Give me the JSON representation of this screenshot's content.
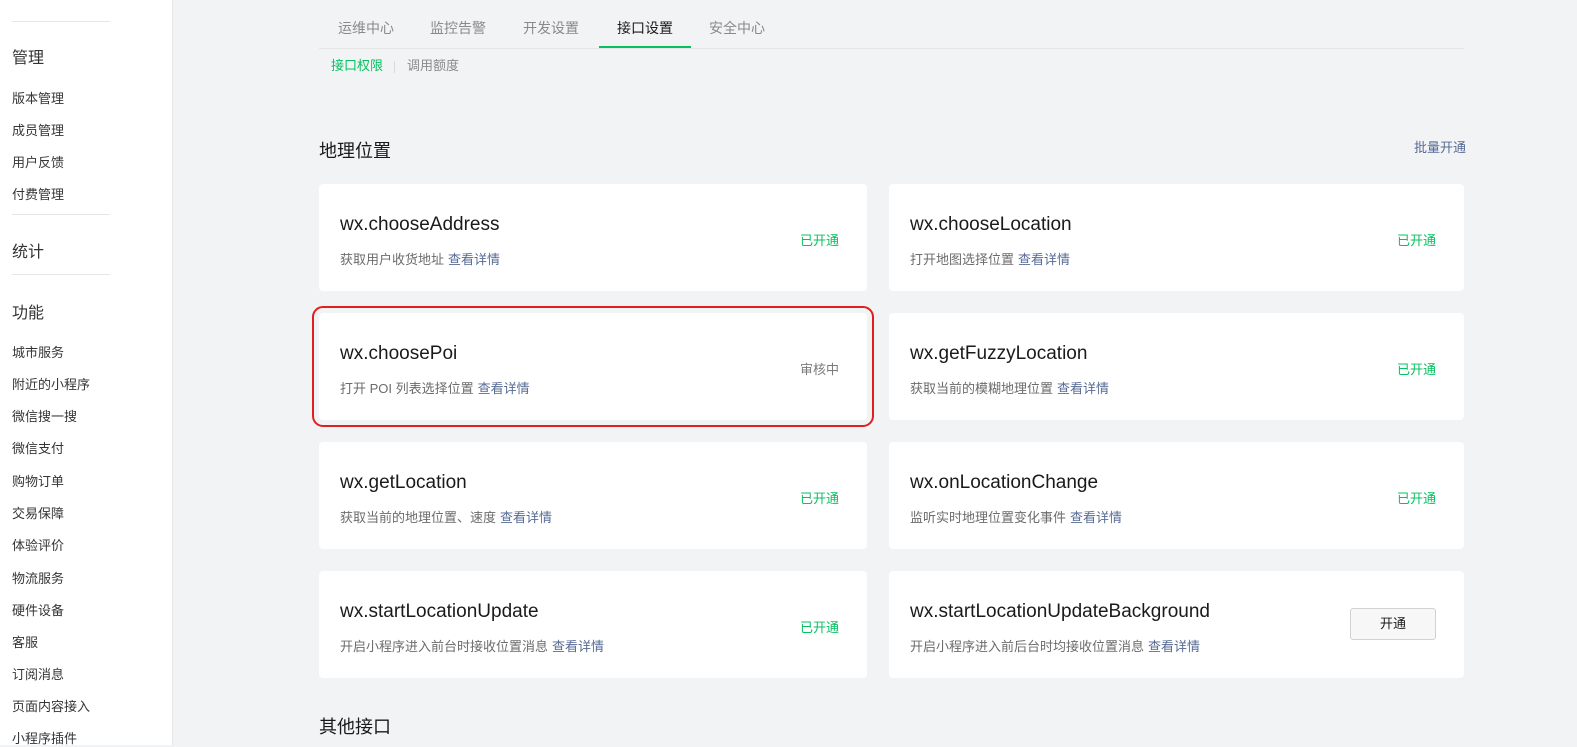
{
  "sidebar": {
    "sections": [
      {
        "title": "管理",
        "items": [
          "版本管理",
          "成员管理",
          "用户反馈",
          "付费管理"
        ]
      },
      {
        "title": "统计",
        "items": []
      },
      {
        "title": "功能",
        "items": [
          "城市服务",
          "附近的小程序",
          "微信搜一搜",
          "微信支付",
          "购物订单",
          "交易保障",
          "体验评价",
          "物流服务",
          "硬件设备",
          "客服",
          "订阅消息",
          "页面内容接入",
          "小程序插件"
        ]
      }
    ]
  },
  "tabs": [
    "运维中心",
    "监控告警",
    "开发设置",
    "接口设置",
    "安全中心"
  ],
  "active_tab": "接口设置",
  "subtabs": [
    "接口权限",
    "调用额度"
  ],
  "geo_section": {
    "title": "地理位置",
    "batch_open": "批量开通",
    "detail_label": "查看详情",
    "open_button": "开通",
    "cards": [
      {
        "name": "wx.chooseAddress",
        "desc": "获取用户收货地址",
        "status": "已开通"
      },
      {
        "name": "wx.chooseLocation",
        "desc": "打开地图选择位置",
        "status": "已开通"
      },
      {
        "name": "wx.choosePoi",
        "desc": "打开 POI 列表选择位置",
        "status": "审核中"
      },
      {
        "name": "wx.getFuzzyLocation",
        "desc": "获取当前的模糊地理位置",
        "status": "已开通"
      },
      {
        "name": "wx.getLocation",
        "desc": "获取当前的地理位置、速度",
        "status": "已开通"
      },
      {
        "name": "wx.onLocationChange",
        "desc": "监听实时地理位置变化事件",
        "status": "已开通"
      },
      {
        "name": "wx.startLocationUpdate",
        "desc": "开启小程序进入前台时接收位置消息",
        "status": "已开通"
      },
      {
        "name": "wx.startLocationUpdateBackground",
        "desc": "开启小程序进入前后台时均接收位置消息",
        "status": ""
      }
    ]
  },
  "other_section": {
    "title": "其他接口"
  },
  "colors": {
    "accent": "#07c160",
    "link": "#576b95",
    "highlight": "#e02020"
  }
}
